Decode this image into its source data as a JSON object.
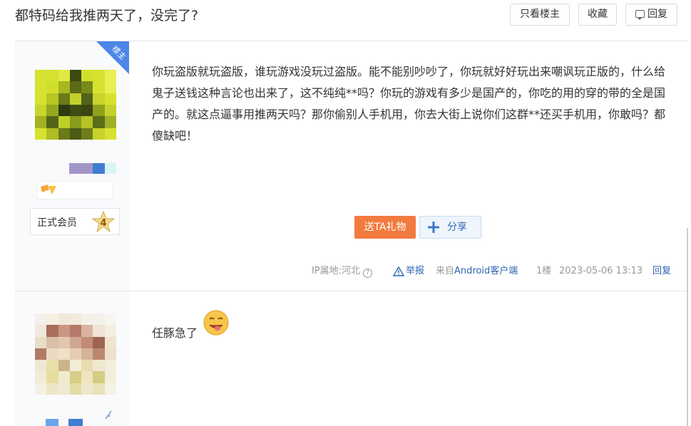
{
  "header": {
    "title": "都特码给我推两天了，没完了?",
    "only_op_label": "只看楼主",
    "favorite_label": "收藏",
    "reply_label": "回复"
  },
  "floor1": {
    "corner_badge": "楼主",
    "member_label": "正式会员",
    "member_level": "4",
    "content": "你玩盗版就玩盗版，谁玩游戏没玩过盗版。能不能别吵吵了，你玩就好好玩出来嘲讽玩正版的，什么给鬼子送钱这种言论也出来了，这不纯纯**吗？你玩的游戏有多少是国产的，你吃的用的穿的带的全是国产的。就这点逼事用推两天吗？那你偷别人手机用，你去大街上说你们这群**还买手机用，你敢吗？都傻缺吧！",
    "gift_label": "送TA礼物",
    "share_label": "分享",
    "ip_label": "IP属地:河北",
    "report_label": "举报",
    "source_prefix": "来自",
    "source_client": "Android客户端",
    "floor_no": "1楼",
    "timestamp": "2023-05-06 13:13",
    "reply_label": "回复"
  },
  "floor2": {
    "content": "任豚急了",
    "emoji_icon": "drooling-face-emoji"
  },
  "colors": {
    "accent_blue": "#2d64b3",
    "gift_orange": "#f27a3f",
    "corner_blue": "#4b86e8",
    "sidebar_bg": "#f9fafc"
  }
}
